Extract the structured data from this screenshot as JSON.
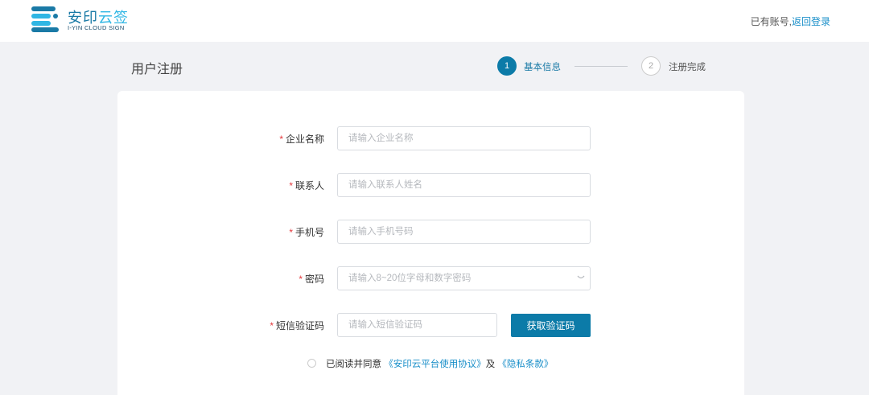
{
  "header": {
    "logo_title_main": "安印",
    "logo_title_accent": "云签",
    "logo_subtitle": "I-YIN CLOUD SIGN",
    "account_prompt": "已有账号,",
    "login_link": "返回登录"
  },
  "page": {
    "title": "用户注册"
  },
  "steps": [
    {
      "number": "1",
      "label": "基本信息",
      "state": "active"
    },
    {
      "number": "2",
      "label": "注册完成",
      "state": "pending"
    }
  ],
  "form": {
    "company": {
      "label": "企业名称",
      "placeholder": "请输入企业名称",
      "value": ""
    },
    "contact": {
      "label": "联系人",
      "placeholder": "请输入联系人姓名",
      "value": ""
    },
    "phone": {
      "label": "手机号",
      "placeholder": "请输入手机号码",
      "value": ""
    },
    "password": {
      "label": "密码",
      "placeholder": "请输入8~20位字母和数字密码",
      "value": ""
    },
    "sms": {
      "label": "短信验证码",
      "placeholder": "请输入短信验证码",
      "value": "",
      "button": "获取验证码"
    },
    "required_mark": "*"
  },
  "agreement": {
    "prefix": "已阅读并同意",
    "terms_link": "《安印云平台使用协议》",
    "conjunction": "及",
    "privacy_link": "《隐私条款》",
    "checked": false
  },
  "colors": {
    "primary": "#0c7ba8",
    "link": "#1a8fc9",
    "required": "#e4393c",
    "background": "#f1f2f5"
  }
}
